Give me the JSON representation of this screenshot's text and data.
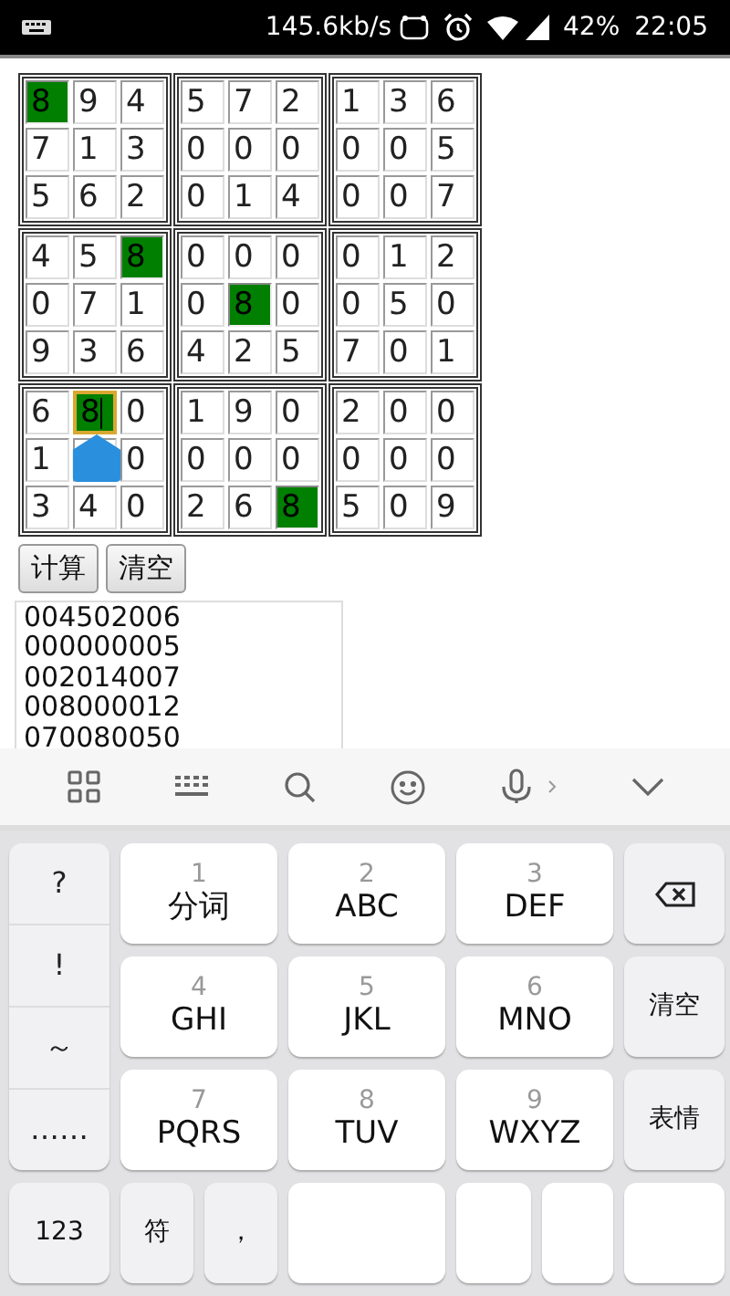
{
  "status_bar": {
    "speed": "145.6kb/s",
    "battery": "42%",
    "time": "22:05"
  },
  "sudoku": {
    "rows": [
      {
        "cells": [
          {
            "value": "8",
            "highlighted": true,
            "focused": false
          },
          {
            "value": "9",
            "highlighted": false,
            "focused": false
          },
          {
            "value": "4",
            "highlighted": false,
            "focused": false
          },
          {
            "value": "5",
            "highlighted": false,
            "focused": false
          },
          {
            "value": "7",
            "highlighted": false,
            "focused": false
          },
          {
            "value": "2",
            "highlighted": false,
            "focused": false
          },
          {
            "value": "1",
            "highlighted": false,
            "focused": false
          },
          {
            "value": "3",
            "highlighted": false,
            "focused": false
          },
          {
            "value": "6",
            "highlighted": false,
            "focused": false
          }
        ]
      },
      {
        "cells": [
          {
            "value": "7",
            "highlighted": false,
            "focused": false
          },
          {
            "value": "1",
            "highlighted": false,
            "focused": false
          },
          {
            "value": "3",
            "highlighted": false,
            "focused": false
          },
          {
            "value": "0",
            "highlighted": false,
            "focused": false
          },
          {
            "value": "0",
            "highlighted": false,
            "focused": false
          },
          {
            "value": "0",
            "highlighted": false,
            "focused": false
          },
          {
            "value": "0",
            "highlighted": false,
            "focused": false
          },
          {
            "value": "0",
            "highlighted": false,
            "focused": false
          },
          {
            "value": "5",
            "highlighted": false,
            "focused": false
          }
        ]
      },
      {
        "cells": [
          {
            "value": "5",
            "highlighted": false,
            "focused": false
          },
          {
            "value": "6",
            "highlighted": false,
            "focused": false
          },
          {
            "value": "2",
            "highlighted": false,
            "focused": false
          },
          {
            "value": "0",
            "highlighted": false,
            "focused": false
          },
          {
            "value": "1",
            "highlighted": false,
            "focused": false
          },
          {
            "value": "4",
            "highlighted": false,
            "focused": false
          },
          {
            "value": "0",
            "highlighted": false,
            "focused": false
          },
          {
            "value": "0",
            "highlighted": false,
            "focused": false
          },
          {
            "value": "7",
            "highlighted": false,
            "focused": false
          }
        ]
      },
      {
        "cells": [
          {
            "value": "4",
            "highlighted": false,
            "focused": false
          },
          {
            "value": "5",
            "highlighted": false,
            "focused": false
          },
          {
            "value": "8",
            "highlighted": true,
            "focused": false
          },
          {
            "value": "0",
            "highlighted": false,
            "focused": false
          },
          {
            "value": "0",
            "highlighted": false,
            "focused": false
          },
          {
            "value": "0",
            "highlighted": false,
            "focused": false
          },
          {
            "value": "0",
            "highlighted": false,
            "focused": false
          },
          {
            "value": "1",
            "highlighted": false,
            "focused": false
          },
          {
            "value": "2",
            "highlighted": false,
            "focused": false
          }
        ]
      },
      {
        "cells": [
          {
            "value": "0",
            "highlighted": false,
            "focused": false
          },
          {
            "value": "7",
            "highlighted": false,
            "focused": false
          },
          {
            "value": "1",
            "highlighted": false,
            "focused": false
          },
          {
            "value": "0",
            "highlighted": false,
            "focused": false
          },
          {
            "value": "8",
            "highlighted": true,
            "focused": false
          },
          {
            "value": "0",
            "highlighted": false,
            "focused": false
          },
          {
            "value": "0",
            "highlighted": false,
            "focused": false
          },
          {
            "value": "5",
            "highlighted": false,
            "focused": false
          },
          {
            "value": "0",
            "highlighted": false,
            "focused": false
          }
        ]
      },
      {
        "cells": [
          {
            "value": "9",
            "highlighted": false,
            "focused": false
          },
          {
            "value": "3",
            "highlighted": false,
            "focused": false
          },
          {
            "value": "6",
            "highlighted": false,
            "focused": false
          },
          {
            "value": "4",
            "highlighted": false,
            "focused": false
          },
          {
            "value": "2",
            "highlighted": false,
            "focused": false
          },
          {
            "value": "5",
            "highlighted": false,
            "focused": false
          },
          {
            "value": "7",
            "highlighted": false,
            "focused": false
          },
          {
            "value": "0",
            "highlighted": false,
            "focused": false
          },
          {
            "value": "1",
            "highlighted": false,
            "focused": false
          }
        ]
      },
      {
        "cells": [
          {
            "value": "6",
            "highlighted": false,
            "focused": false
          },
          {
            "value": "8",
            "highlighted": true,
            "focused": true
          },
          {
            "value": "0",
            "highlighted": false,
            "focused": false
          },
          {
            "value": "1",
            "highlighted": false,
            "focused": false
          },
          {
            "value": "9",
            "highlighted": false,
            "focused": false
          },
          {
            "value": "0",
            "highlighted": false,
            "focused": false
          },
          {
            "value": "2",
            "highlighted": false,
            "focused": false
          },
          {
            "value": "0",
            "highlighted": false,
            "focused": false
          },
          {
            "value": "0",
            "highlighted": false,
            "focused": false
          }
        ]
      },
      {
        "cells": [
          {
            "value": "1",
            "highlighted": false,
            "focused": false
          },
          {
            "handle_over": true
          },
          {
            "value": "0",
            "highlighted": false,
            "focused": false
          },
          {
            "value": "0",
            "highlighted": false,
            "focused": false
          },
          {
            "value": "0",
            "highlighted": false,
            "focused": false
          },
          {
            "value": "0",
            "highlighted": false,
            "focused": false
          },
          {
            "value": "0",
            "highlighted": false,
            "focused": false
          },
          {
            "value": "0",
            "highlighted": false,
            "focused": false
          },
          {
            "value": "0",
            "highlighted": false,
            "focused": false
          }
        ]
      },
      {
        "cells": [
          {
            "value": "3",
            "highlighted": false,
            "focused": false
          },
          {
            "value": "4",
            "highlighted": false,
            "focused": false
          },
          {
            "value": "0",
            "highlighted": false,
            "focused": false
          },
          {
            "value": "2",
            "highlighted": false,
            "focused": false
          },
          {
            "value": "6",
            "highlighted": false,
            "focused": false
          },
          {
            "value": "8",
            "highlighted": true,
            "focused": false
          },
          {
            "value": "5",
            "highlighted": false,
            "focused": false
          },
          {
            "value": "0",
            "highlighted": false,
            "focused": false
          },
          {
            "value": "9",
            "highlighted": false,
            "focused": false
          }
        ]
      }
    ]
  },
  "buttons": [
    "计算",
    "清空"
  ],
  "output_lines": [
    "004502006",
    "000000005",
    "002014007",
    "008000012",
    "070080050"
  ],
  "keyboard": {
    "symbols": [
      "?",
      "!",
      "～",
      "……"
    ],
    "rows": [
      [
        {
          "kind": "t9",
          "digit": "1",
          "label": "分词"
        },
        {
          "kind": "t9",
          "digit": "2",
          "label": "ABC"
        },
        {
          "kind": "t9",
          "digit": "3",
          "label": "DEF"
        },
        {
          "kind": "backspace"
        }
      ],
      [
        {
          "kind": "t9",
          "digit": "4",
          "label": "GHI"
        },
        {
          "kind": "t9",
          "digit": "5",
          "label": "JKL"
        },
        {
          "kind": "t9",
          "digit": "6",
          "label": "MNO"
        },
        {
          "kind": "text",
          "label": "清空"
        }
      ],
      [
        {
          "kind": "t9",
          "digit": "7",
          "label": "PQRS"
        },
        {
          "kind": "t9",
          "digit": "8",
          "label": "TUV"
        },
        {
          "kind": "t9",
          "digit": "9",
          "label": "WXYZ"
        },
        {
          "kind": "text",
          "label": "表情"
        }
      ]
    ],
    "bottom": [
      {
        "kind": "text",
        "label": "123"
      },
      {
        "kind": "text",
        "label": "符"
      },
      {
        "kind": "text",
        "label": "，"
      },
      {
        "kind": "blank"
      },
      {
        "kind": "blank"
      },
      {
        "kind": "blank"
      },
      {
        "kind": "blank"
      }
    ]
  }
}
